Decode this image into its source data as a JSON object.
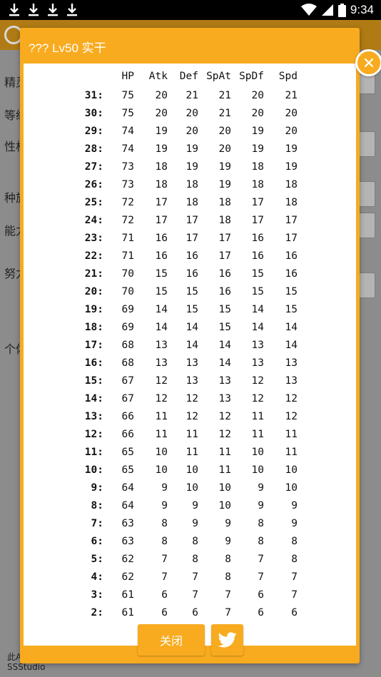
{
  "status_bar": {
    "time": "9:34",
    "icons": [
      "download-icon",
      "download-icon",
      "download-icon",
      "download-icon",
      "wifi-icon",
      "signal-icon",
      "battery-icon"
    ]
  },
  "background_app": {
    "labels": [
      "精灵",
      "等级",
      "性格",
      "种族",
      "能力",
      "努力",
      "个体"
    ],
    "footer_line1": "此App",
    "footer_line2": "SSStudio"
  },
  "dialog": {
    "title": "??? Lv50 实干",
    "close_icon": "close-icon",
    "close_button_label": "关闭",
    "share_icon": "twitter-bird-icon",
    "accent_color": "#f8ab1f",
    "table": {
      "headers": [
        "",
        "HP",
        "Atk",
        "Def",
        "SpAt",
        "SpDf",
        "Spd"
      ],
      "rows": [
        [
          "31:",
          "75",
          "20",
          "21",
          "21",
          "20",
          "21"
        ],
        [
          "30:",
          "75",
          "20",
          "20",
          "21",
          "20",
          "20"
        ],
        [
          "29:",
          "74",
          "19",
          "20",
          "20",
          "19",
          "20"
        ],
        [
          "28:",
          "74",
          "19",
          "19",
          "20",
          "19",
          "19"
        ],
        [
          "27:",
          "73",
          "18",
          "19",
          "19",
          "18",
          "19"
        ],
        [
          "26:",
          "73",
          "18",
          "18",
          "19",
          "18",
          "18"
        ],
        [
          "25:",
          "72",
          "17",
          "18",
          "18",
          "17",
          "18"
        ],
        [
          "24:",
          "72",
          "17",
          "17",
          "18",
          "17",
          "17"
        ],
        [
          "23:",
          "71",
          "16",
          "17",
          "17",
          "16",
          "17"
        ],
        [
          "22:",
          "71",
          "16",
          "16",
          "17",
          "16",
          "16"
        ],
        [
          "21:",
          "70",
          "15",
          "16",
          "16",
          "15",
          "16"
        ],
        [
          "20:",
          "70",
          "15",
          "15",
          "16",
          "15",
          "15"
        ],
        [
          "19:",
          "69",
          "14",
          "15",
          "15",
          "14",
          "15"
        ],
        [
          "18:",
          "69",
          "14",
          "14",
          "15",
          "14",
          "14"
        ],
        [
          "17:",
          "68",
          "13",
          "14",
          "14",
          "13",
          "14"
        ],
        [
          "16:",
          "68",
          "13",
          "13",
          "14",
          "13",
          "13"
        ],
        [
          "15:",
          "67",
          "12",
          "13",
          "13",
          "12",
          "13"
        ],
        [
          "14:",
          "67",
          "12",
          "12",
          "13",
          "12",
          "12"
        ],
        [
          "13:",
          "66",
          "11",
          "12",
          "12",
          "11",
          "12"
        ],
        [
          "12:",
          "66",
          "11",
          "11",
          "12",
          "11",
          "11"
        ],
        [
          "11:",
          "65",
          "10",
          "11",
          "11",
          "10",
          "11"
        ],
        [
          "10:",
          "65",
          "10",
          "10",
          "11",
          "10",
          "10"
        ],
        [
          "9:",
          "64",
          "9",
          "10",
          "10",
          "9",
          "10"
        ],
        [
          "8:",
          "64",
          "9",
          "9",
          "10",
          "9",
          "9"
        ],
        [
          "7:",
          "63",
          "8",
          "9",
          "9",
          "8",
          "9"
        ],
        [
          "6:",
          "63",
          "8",
          "8",
          "9",
          "8",
          "8"
        ],
        [
          "5:",
          "62",
          "7",
          "8",
          "8",
          "7",
          "8"
        ],
        [
          "4:",
          "62",
          "7",
          "7",
          "8",
          "7",
          "7"
        ],
        [
          "3:",
          "61",
          "6",
          "7",
          "7",
          "6",
          "7"
        ],
        [
          "2:",
          "61",
          "6",
          "6",
          "7",
          "6",
          "6"
        ]
      ]
    }
  }
}
